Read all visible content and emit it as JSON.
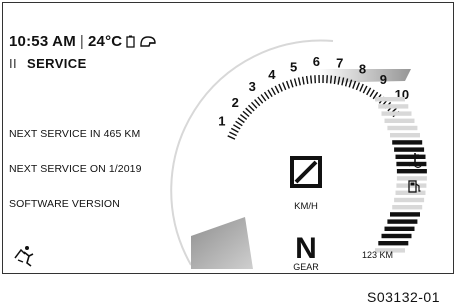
{
  "status": {
    "time": "10:53 AM",
    "separator": "|",
    "temperature": "24°C",
    "battery_icon": "battery-icon",
    "connection_icon": "helmet-connect-icon"
  },
  "menu": {
    "bars_glyph": "II",
    "title": "SERVICE"
  },
  "info": {
    "next_service_km": "NEXT SERVICE IN 465 KM",
    "next_service_date": "NEXT SERVICE ON 1/2019",
    "software_version": "SOFTWARE VERSION"
  },
  "tachometer": {
    "labels": [
      "1",
      "2",
      "3",
      "4",
      "5",
      "6",
      "7",
      "8",
      "9",
      "10"
    ],
    "current_rpm_thousands": 1
  },
  "center": {
    "speed_glyph": "speed-placeholder-icon",
    "speed_unit": "KM/H"
  },
  "gear": {
    "value": "N",
    "label": "GEAR"
  },
  "fuel_range": {
    "text": "123 KM"
  },
  "icons": {
    "coolant": "coolant-temperature-icon",
    "fuel": "fuel-pump-icon",
    "rider": "rider-seat-icon"
  },
  "figure_id": "S03132-01"
}
